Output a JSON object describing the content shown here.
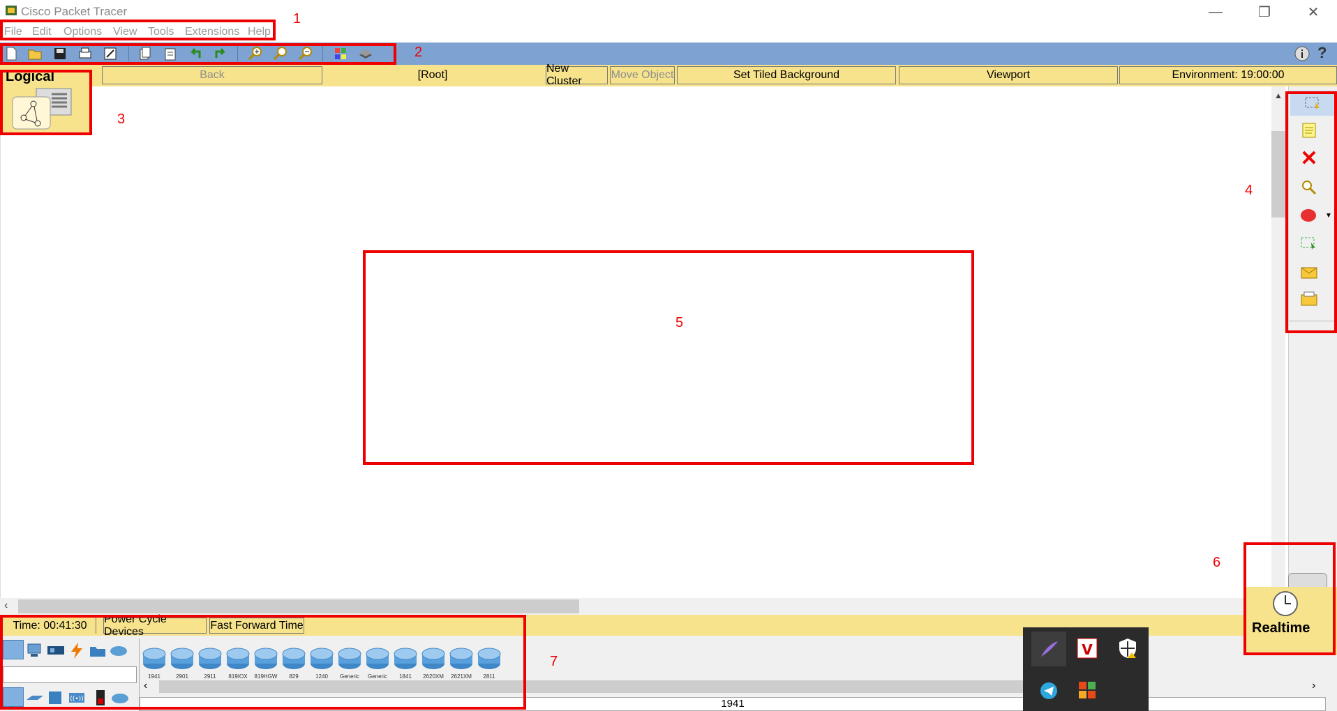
{
  "window": {
    "title": "Cisco Packet Tracer",
    "controls": {
      "minimize": "—",
      "restore": "❐",
      "close": "✕"
    }
  },
  "menu": [
    "File",
    "Edit",
    "Options",
    "View",
    "Tools",
    "Extensions",
    "Help"
  ],
  "toolbar": {
    "icons": [
      "new-file-icon",
      "open-folder-icon",
      "save-icon",
      "print-icon",
      "activity-wizard-icon",
      "copy-icon",
      "paste-icon",
      "undo-icon",
      "redo-icon",
      "zoom-in-icon",
      "zoom-reset-icon",
      "zoom-out-icon",
      "palette-icon",
      "custom-device-icon"
    ],
    "right_icons": [
      "info-icon",
      "help-icon"
    ]
  },
  "workspace_bar": {
    "back": "Back",
    "root": "[Root]",
    "new_cluster": "New Cluster",
    "move_object": "Move Object",
    "set_tiled_background": "Set Tiled Background",
    "viewport": "Viewport",
    "environment": "Environment: 19:00:00"
  },
  "logical_tab": {
    "label": "Logical"
  },
  "right_palette": [
    "select-icon",
    "note-icon",
    "delete-icon",
    "inspect-icon",
    "draw-ellipse-icon",
    "resize-icon",
    "add-simple-pdu-icon",
    "add-complex-pdu-icon"
  ],
  "bottom_bar": {
    "time": "Time: 00:41:30",
    "power_cycle": "Power Cycle Devices",
    "fast_forward": "Fast Forward Time"
  },
  "realtime_tab": {
    "label": "Realtime"
  },
  "device_categories_top": [
    "network-devices-icon",
    "end-devices-icon",
    "components-icon",
    "connections-icon",
    "miscellaneous-icon",
    "multiuser-icon"
  ],
  "device_categories_bottom": [
    "routers-icon",
    "switches-icon",
    "hubs-icon",
    "wireless-devices-icon",
    "security-icon",
    "wan-emulation-icon"
  ],
  "devices": [
    "1941",
    "2901",
    "2911",
    "819IOX",
    "819HGW",
    "829",
    "1240",
    "Generic",
    "Generic",
    "1841",
    "2620XM",
    "2621XM",
    "2811"
  ],
  "selected_device": "1941",
  "annotations": [
    "1",
    "2",
    "3",
    "4",
    "5",
    "6",
    "7"
  ],
  "taskbar_flyout": [
    "feather-app-icon",
    "vivaldi-icon",
    "security-shield-icon",
    "telegram-icon",
    "office-icon"
  ]
}
